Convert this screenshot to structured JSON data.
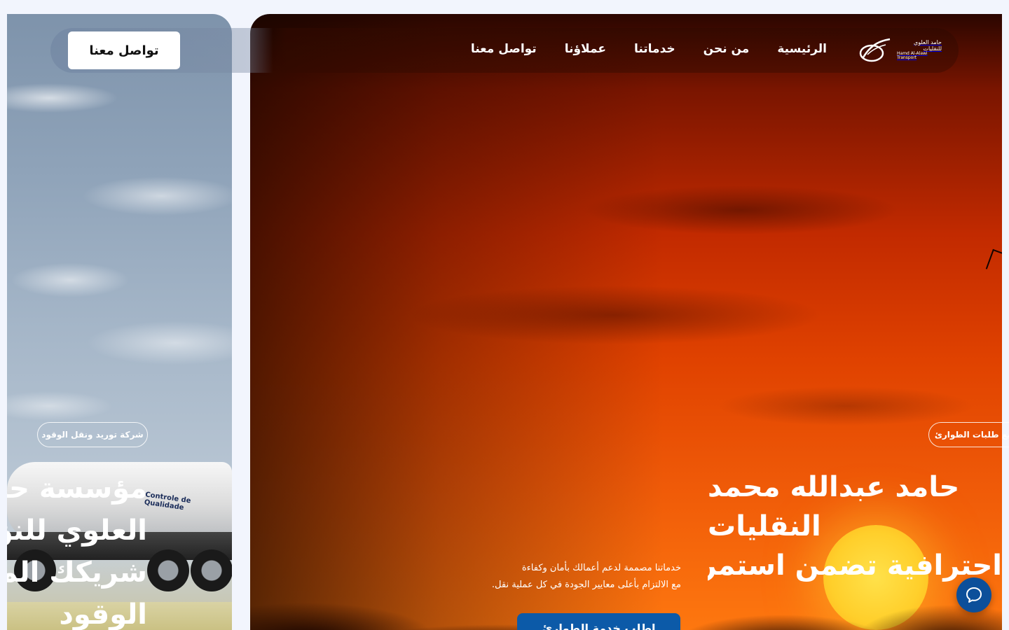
{
  "colors": {
    "page_background": "#f2f5fd",
    "primary_button": "#0c5aa8",
    "chat_button": "#0c4f9a",
    "text_on_image": "#ffffff"
  },
  "header": {
    "logo": {
      "icon": "brand-logo-icon",
      "arabic_name": "حامد العلوي للنقليات",
      "english_name": "Hamd Al-Alawi Transport"
    },
    "nav": [
      {
        "label": "الرئيسية"
      },
      {
        "label": "من نحن"
      },
      {
        "label": "خدماتنا"
      },
      {
        "label": "عملاؤنا"
      },
      {
        "label": "تواصل معنا"
      }
    ],
    "cta_label": "تواصل معنا"
  },
  "slides": {
    "left": {
      "badge": "شركة توريد ونقل الوقود",
      "heading_lines": [
        "مؤسسة حا",
        "العلوي للنق",
        "شريكك الم",
        "الوقود"
      ],
      "truck_label": "Controle de Qualidade"
    },
    "right": {
      "badge": "لجميع طلبات الطوارئ",
      "heading_lines": [
        "حامد عبدالله محمد",
        "النقليات",
        "احترافية تضمن استمرارية"
      ],
      "description_lines": [
        "خدماتنا مصممة لدعم أعمالك بأمان وكفاءة",
        "مع الالتزام بأعلى معايير الجودة في كل عملية نقل."
      ],
      "cta_label": "اطلب خدمة الطوارئ"
    }
  },
  "chat": {
    "icon": "chat-bubble-icon"
  }
}
